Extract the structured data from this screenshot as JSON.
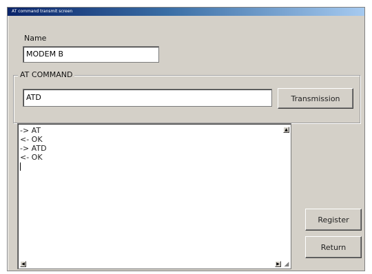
{
  "window": {
    "title": "AT command transmit screen"
  },
  "name_section": {
    "label": "Name",
    "value": "MODEM B"
  },
  "at_command": {
    "group_label": "AT COMMAND",
    "value": "ATD",
    "transmit_label": "Transmission"
  },
  "log": {
    "lines": [
      "-> AT",
      "<- OK",
      "-> ATD",
      "<- OK"
    ]
  },
  "buttons": {
    "register_label": "Register",
    "return_label": "Return"
  },
  "icons": {
    "scroll_up": "triangle-up",
    "scroll_left": "triangle-left",
    "scroll_right": "triangle-right",
    "resize": "resize-grip"
  }
}
